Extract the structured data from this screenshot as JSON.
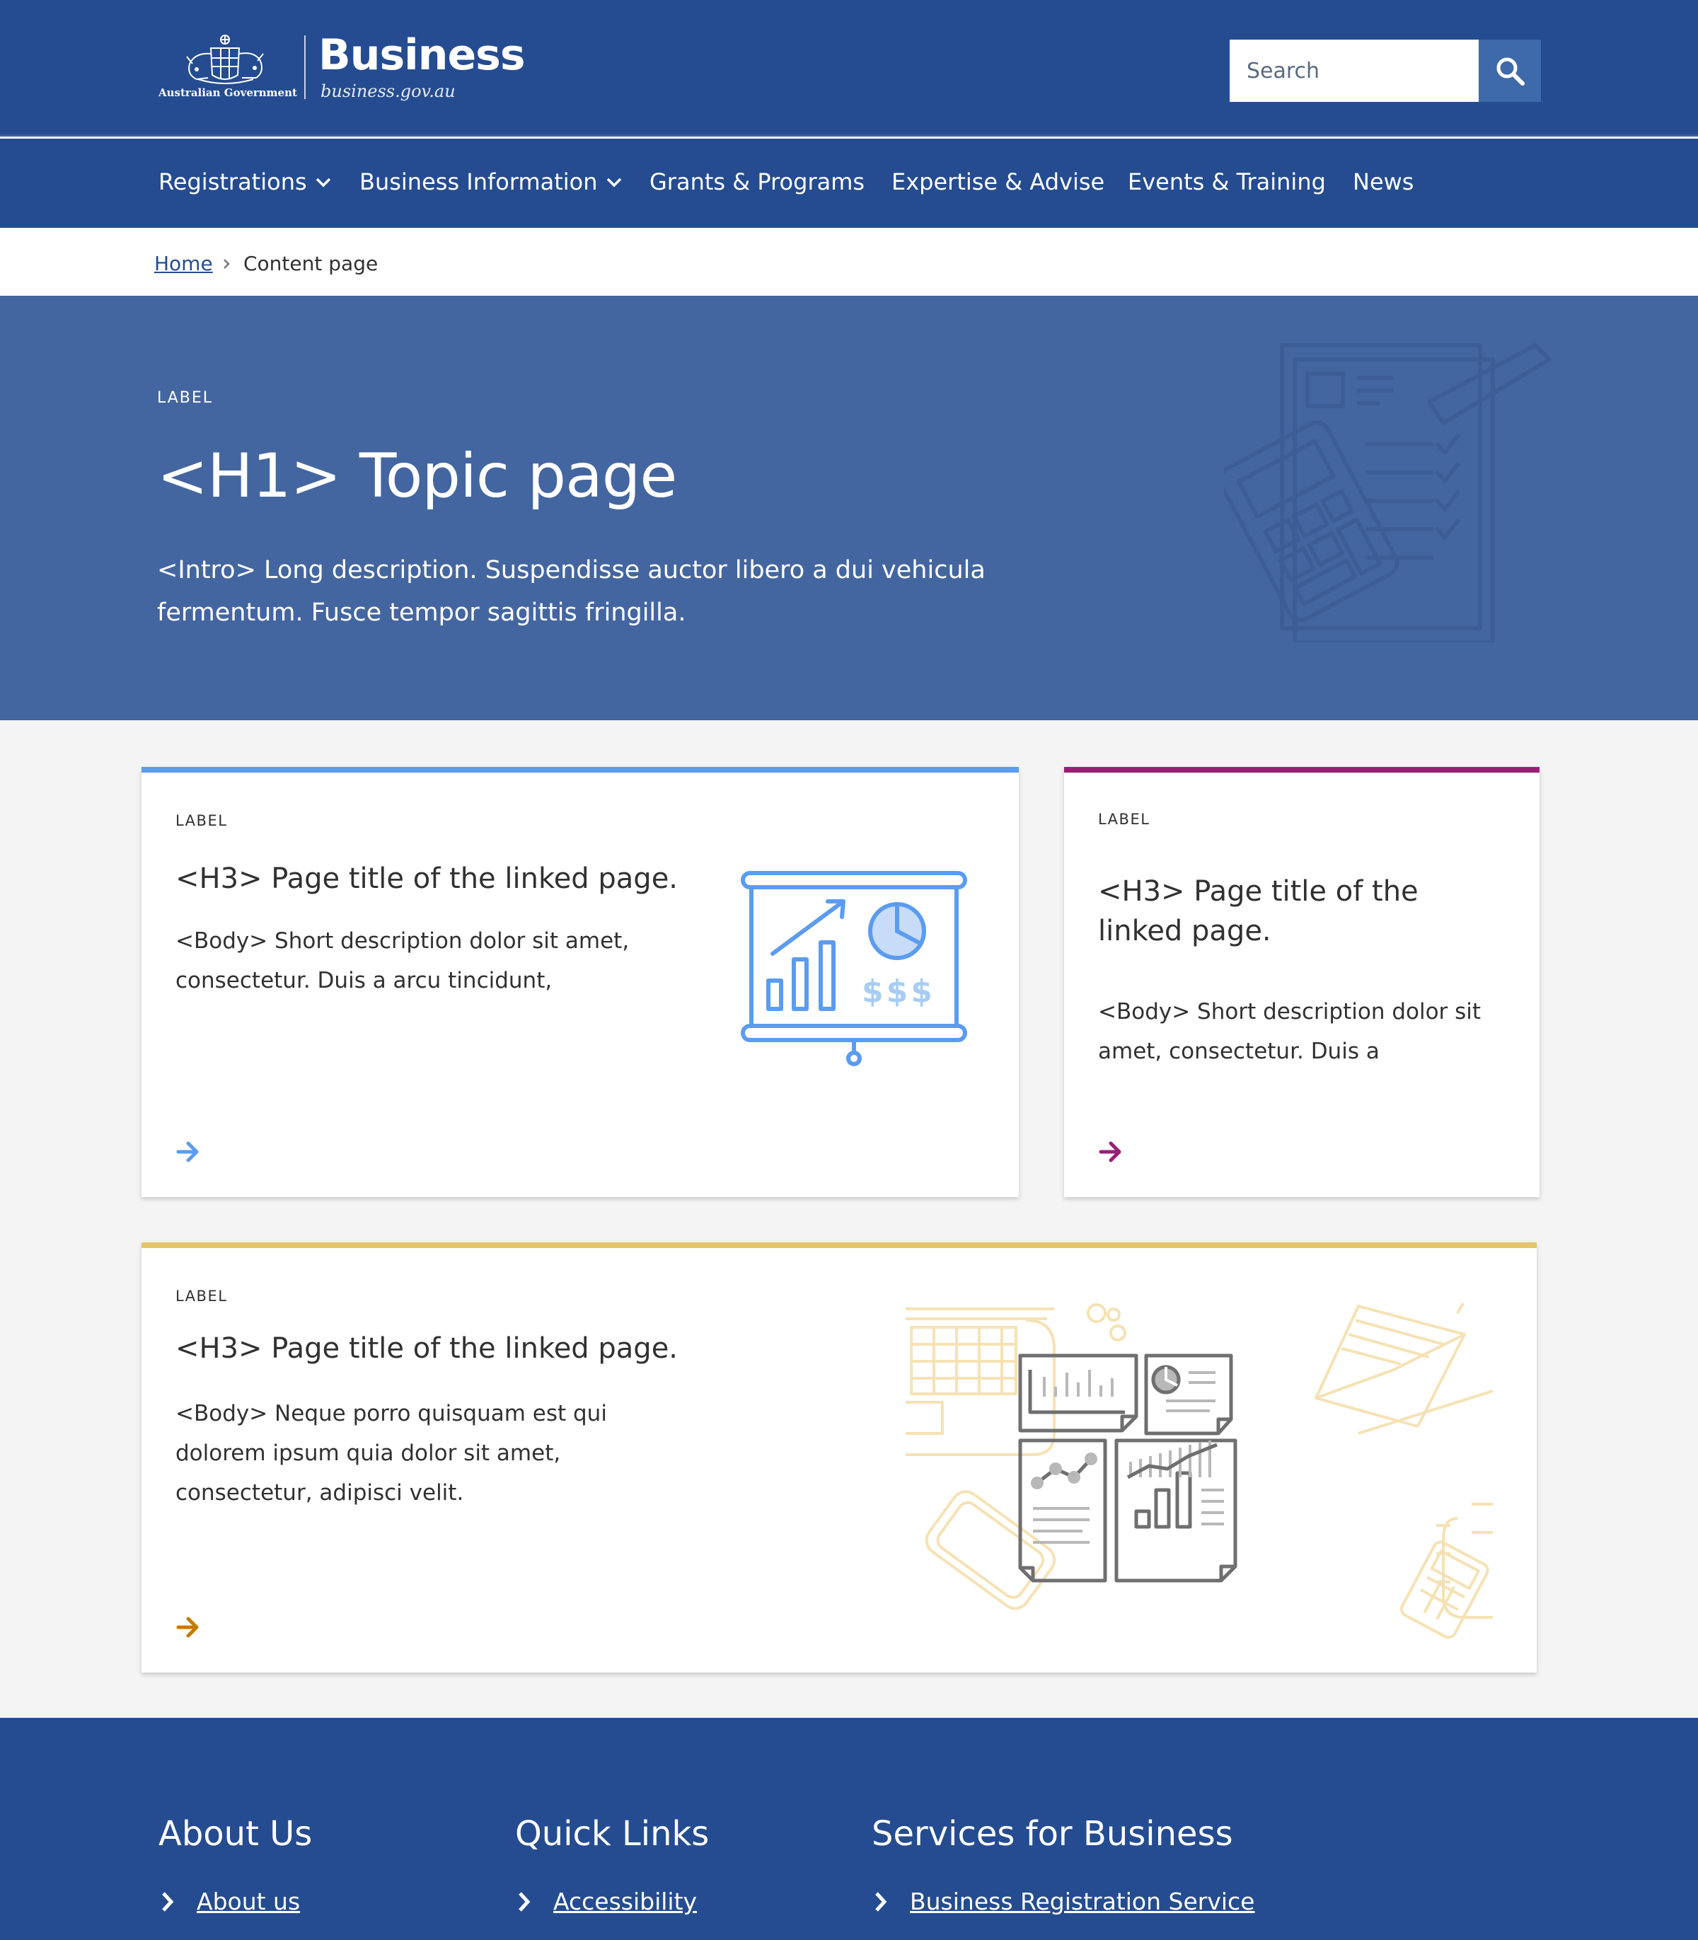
{
  "header": {
    "government_name": "Australian Government",
    "brand_title": "Business",
    "brand_url": "business.gov.au",
    "search_placeholder": "Search"
  },
  "nav": {
    "items": [
      {
        "label": "Registrations",
        "has_dropdown": true
      },
      {
        "label": "Business Information",
        "has_dropdown": true
      },
      {
        "label": "Grants & Programs",
        "has_dropdown": false
      },
      {
        "label": "Expertise & Advise",
        "has_dropdown": false
      },
      {
        "label": "Events & Training",
        "has_dropdown": false
      },
      {
        "label": "News",
        "has_dropdown": false
      }
    ]
  },
  "breadcrumb": {
    "home": "Home",
    "current": "Content page"
  },
  "hero": {
    "label": "LABEL",
    "title": "<H1> Topic page",
    "intro": "<Intro> Long description. Suspendisse auctor libero a dui vehicula fermentum. Fusce tempor sagittis fringilla."
  },
  "cards": [
    {
      "label": "LABEL",
      "title": "<H3> Page title of the linked page.",
      "body": "<Body> Short description dolor sit amet, consectetur. Duis a arcu tincidunt,",
      "accent_color": "#5b9cf0",
      "illustration": "presentation-chart-icon"
    },
    {
      "label": "LABEL",
      "title": "<H3> Page title of the linked page.",
      "body": "<Body> Short description dolor sit amet, consectetur. Duis a",
      "accent_color": "#9b1e74"
    },
    {
      "label": "LABEL",
      "title": "<H3> Page title of the linked page.",
      "body": "<Body> Neque porro quisquam est qui dolorem ipsum quia dolor sit amet, consectetur, adipisci velit.",
      "accent_color": "#e6c46a",
      "arrow_color": "#c47a00",
      "illustration": "reports-dashboard-icon"
    }
  ],
  "footer": {
    "columns": [
      {
        "title": "About Us",
        "link": "About us"
      },
      {
        "title": "Quick Links",
        "link": "Accessibility"
      },
      {
        "title": "Services for Business",
        "link": "Business Registration Service"
      }
    ]
  },
  "colors": {
    "header_bg": "#254c90",
    "hero_bg": "#4466a0",
    "page_bg": "#f4f4f4",
    "link": "#254c90"
  }
}
